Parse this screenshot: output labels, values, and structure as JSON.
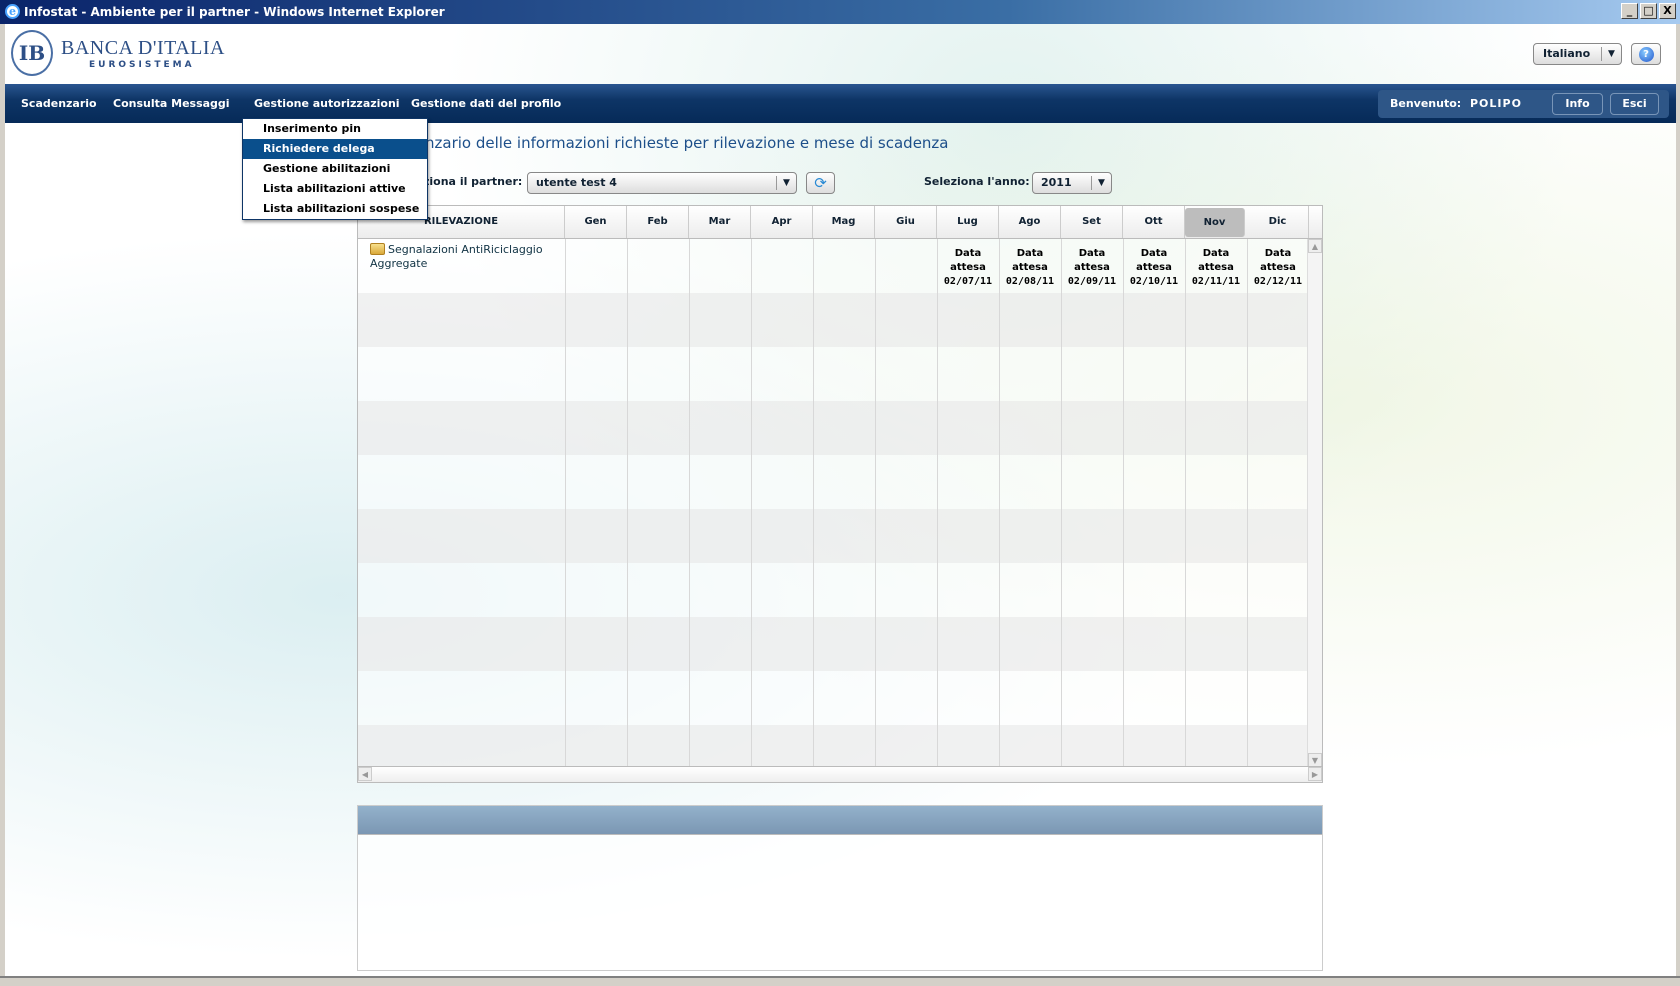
{
  "window": {
    "title": "Infostat - Ambiente per il partner - Windows Internet Explorer",
    "controls": [
      "_",
      "□",
      "X"
    ]
  },
  "header": {
    "logo_line1": "BANCA D'ITALIA",
    "logo_line2": "EUROSISTEMA",
    "language": "Italiano",
    "help_icon": "?"
  },
  "nav": {
    "items": [
      "Scadenzario",
      "Consulta Messaggi",
      "Gestione autorizzazioni",
      "Gestione dati del profilo"
    ],
    "welcome_label": "Benvenuto:",
    "user": "POLIPO",
    "info": "Info",
    "logout": "Esci"
  },
  "menu": {
    "items": [
      "Inserimento pin",
      "Richiedere delega",
      "Gestione abilitazioni",
      "Lista abilitazioni attive",
      "Lista abilitazioni sospese"
    ],
    "selected": "Richiedere delega"
  },
  "main": {
    "title": "nzario delle informazioni richieste per rilevazione e mese di scadenza",
    "partner_label": "ziona il partner:",
    "partner_value": "utente test 4",
    "year_label": "Seleziona l'anno:",
    "year_value": "2011"
  },
  "table": {
    "headers": [
      "RILEVAZIONE",
      "Gen",
      "Feb",
      "Mar",
      "Apr",
      "Mag",
      "Giu",
      "Lug",
      "Ago",
      "Set",
      "Ott",
      "Nov",
      "Dic"
    ],
    "selected_month": "Nov",
    "rows": [
      {
        "rilevazione": "Segnalazioni AntiRiciclaggio Aggregate",
        "cells": [
          {
            "month": "Lug",
            "label": "Data attesa",
            "date": "02/07/11"
          },
          {
            "month": "Ago",
            "label": "Data attesa",
            "date": "02/08/11"
          },
          {
            "month": "Set",
            "label": "Data attesa",
            "date": "02/09/11"
          },
          {
            "month": "Ott",
            "label": "Data attesa",
            "date": "02/10/11"
          },
          {
            "month": "Nov",
            "label": "Data attesa",
            "date": "02/11/11"
          },
          {
            "month": "Dic",
            "label": "Data attesa",
            "date": "02/12/11"
          }
        ]
      }
    ]
  },
  "colors": {
    "nav": "#0e3566",
    "menu_selected": "#0a4f8c",
    "title": "#1d4f8a",
    "panel_header": "#7b97b3"
  }
}
